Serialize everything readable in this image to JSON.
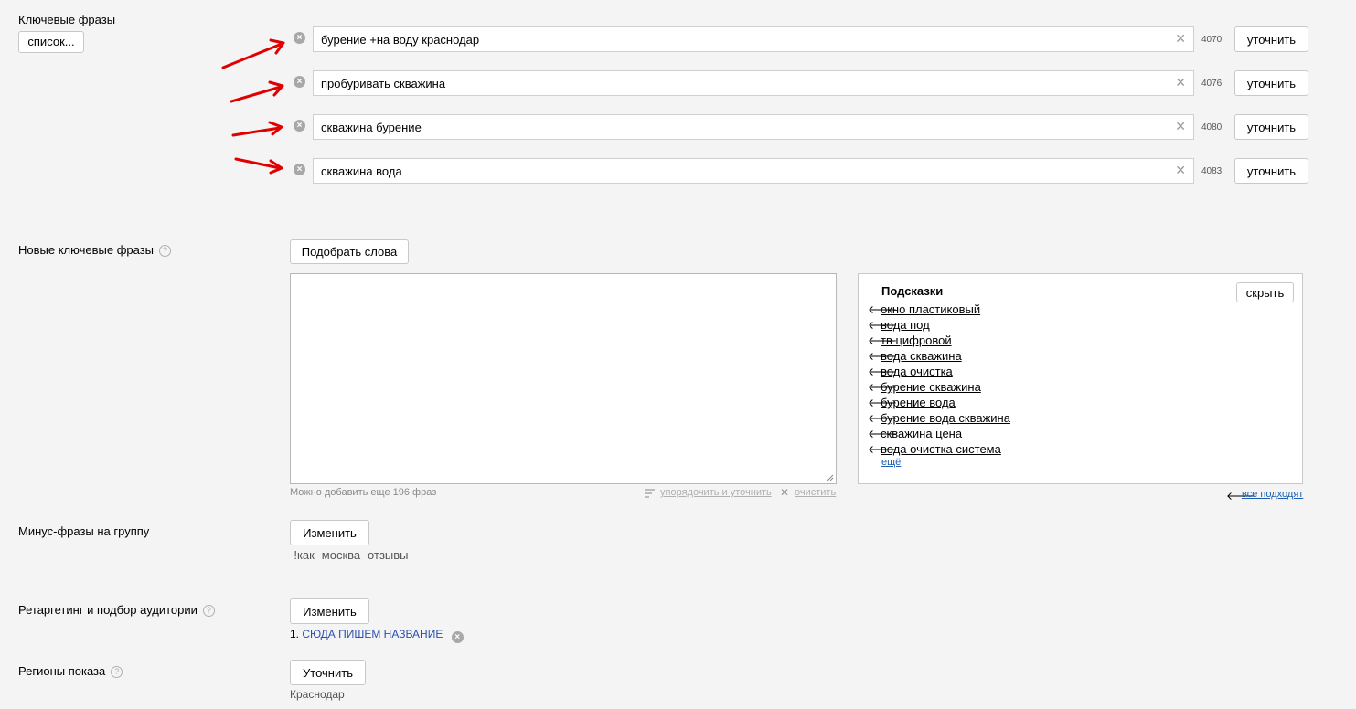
{
  "keywords": {
    "section_label": "Ключевые фразы",
    "list_button": "список...",
    "items": [
      {
        "text": "бурение +на воду краснодар",
        "count": "4070",
        "refine_label": "уточнить"
      },
      {
        "text": "пробуривать скважина",
        "count": "4076",
        "refine_label": "уточнить"
      },
      {
        "text": "скважина бурение",
        "count": "4080",
        "refine_label": "уточнить"
      },
      {
        "text": "скважина вода",
        "count": "4083",
        "refine_label": "уточнить"
      }
    ]
  },
  "new_keywords": {
    "section_label": "Новые ключевые фразы",
    "pick_button": "Подобрать слова",
    "textarea_value": "",
    "remaining_text": "Можно добавить еще 196 фраз",
    "sort_link": "упорядочить и уточнить",
    "clear_link": "очистить",
    "hints": {
      "title": "Подсказки",
      "hide_button": "скрыть",
      "items": [
        "окно пластиковый",
        "вода под",
        "тв цифровой",
        "вода скважина",
        "вода очистка",
        "бурение скважина",
        "бурение вода",
        "бурение вода скважина",
        "скважина цена",
        "вода очистка система"
      ],
      "more_link": "ещё",
      "all_fit_link": "все подходят"
    }
  },
  "minus_phrases": {
    "section_label": "Минус-фразы на группу",
    "change_button": "Изменить",
    "value": "-!как -москва -отзывы"
  },
  "retargeting": {
    "section_label": "Ретаргетинг и подбор аудитории",
    "change_button": "Изменить",
    "item_number": "1.",
    "item_name": "СЮДА ПИШЕМ НАЗВАНИЕ"
  },
  "regions": {
    "section_label": "Регионы показа",
    "refine_button": "Уточнить",
    "value": "Краснодар"
  },
  "colors": {
    "annotation_arrow": "#e00000",
    "link_blue": "#2a4fb0",
    "background": "#f4f4f4"
  }
}
